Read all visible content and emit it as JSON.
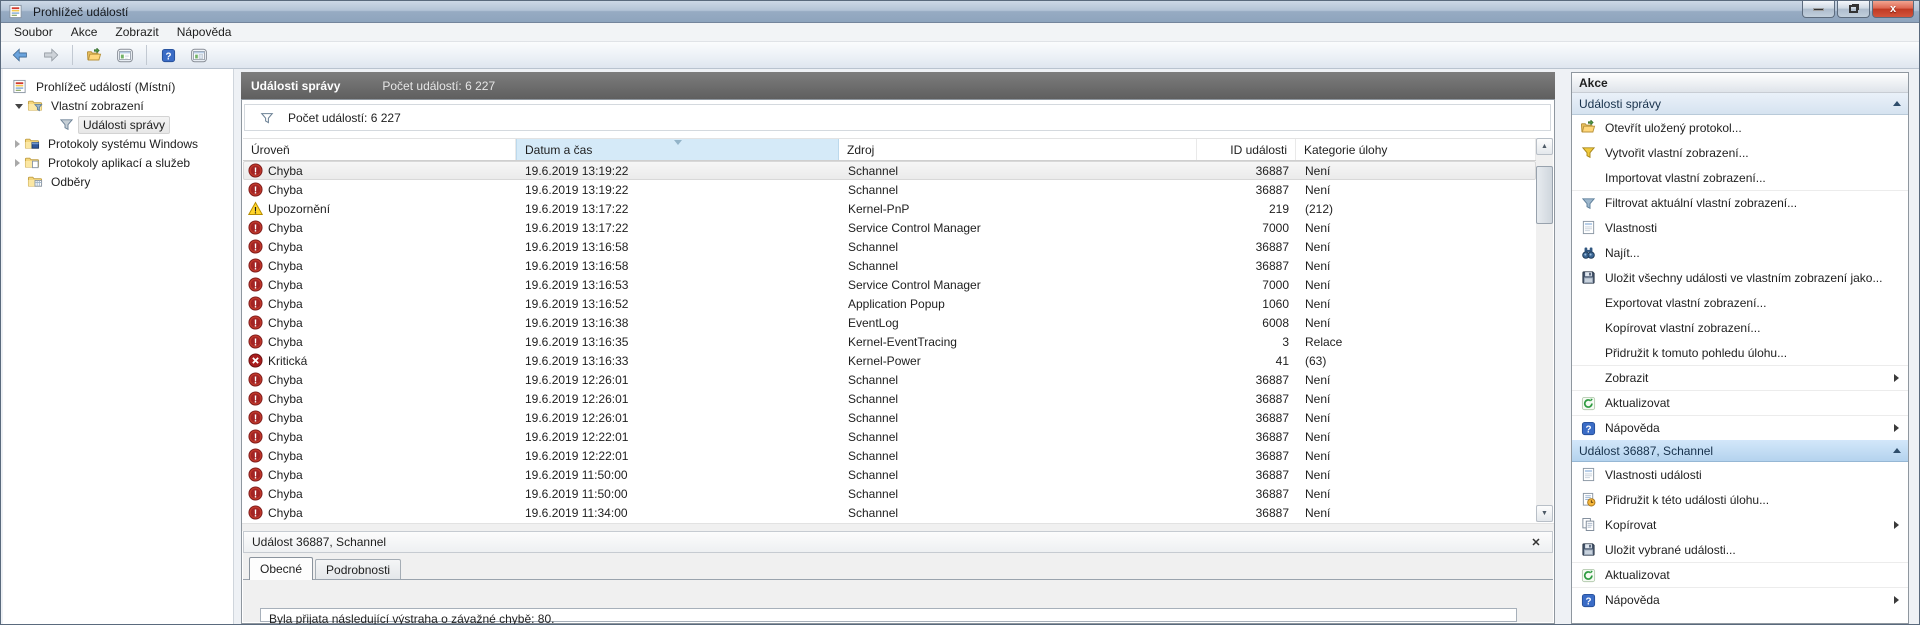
{
  "window": {
    "title": "Prohlížeč událostí",
    "controls": [
      {
        "name": "minimize-button",
        "icon": "minimize-icon"
      },
      {
        "name": "restore-button",
        "icon": "restore-icon"
      },
      {
        "name": "close-button",
        "icon": "close-icon",
        "glyph": "x"
      }
    ]
  },
  "menu": {
    "items": [
      "Soubor",
      "Akce",
      "Zobrazit",
      "Nápověda"
    ]
  },
  "toolbar": {
    "buttons": [
      {
        "name": "back-button",
        "icon": "back-arrow-icon"
      },
      {
        "name": "forward-button",
        "icon": "forward-arrow-icon"
      },
      {
        "name": "separator"
      },
      {
        "name": "open-saved-log-button",
        "icon": "open-folder-icon"
      },
      {
        "name": "show-console-tree-button",
        "icon": "console-tree-icon"
      },
      {
        "name": "separator"
      },
      {
        "name": "help-button",
        "icon": "help-icon"
      },
      {
        "name": "show-action-pane-button",
        "icon": "action-pane-icon"
      }
    ]
  },
  "tree": {
    "root": {
      "label": "Prohlížeč událostí (Místní)",
      "icon": "eventviewer-icon"
    },
    "items": [
      {
        "label": "Vlastní zobrazení",
        "level": 1,
        "expander": "expanded",
        "icon": "folder-filter-icon",
        "selected": false
      },
      {
        "label": "Události správy",
        "level": 2,
        "expander": "none",
        "icon": "filter-icon",
        "selected": true
      },
      {
        "label": "Protokoly systému Windows",
        "level": 1,
        "expander": "collapsed",
        "icon": "folder-system-icon",
        "selected": false
      },
      {
        "label": "Protokoly aplikací a služeb",
        "level": 1,
        "expander": "collapsed",
        "icon": "folder-app-icon",
        "selected": false
      },
      {
        "label": "Odběry",
        "level": 1,
        "expander": "none",
        "icon": "folder-subscription-icon",
        "selected": false
      }
    ]
  },
  "main": {
    "title": "Události správy",
    "subtitle": "Počet událostí: 6 227",
    "filter_summary": "Počet událostí: 6 227",
    "filter_icon": "funnel-icon"
  },
  "chart_data": {
    "type": "table",
    "title": "Události správy",
    "columns": [
      "Úroveň",
      "Datum a čas",
      "Zdroj",
      "ID události",
      "Kategorie úlohy"
    ],
    "sorted_column": "Datum a čas",
    "sort_direction": "desc",
    "rows": [
      {
        "level": "Chyba",
        "severity": "error",
        "datetime": "19.6.2019 13:19:22",
        "source": "Schannel",
        "event_id": "36887",
        "category": "Není",
        "selected": true
      },
      {
        "level": "Chyba",
        "severity": "error",
        "datetime": "19.6.2019 13:19:22",
        "source": "Schannel",
        "event_id": "36887",
        "category": "Není",
        "selected": false
      },
      {
        "level": "Upozornění",
        "severity": "warning",
        "datetime": "19.6.2019 13:17:22",
        "source": "Kernel-PnP",
        "event_id": "219",
        "category": "(212)",
        "selected": false
      },
      {
        "level": "Chyba",
        "severity": "error",
        "datetime": "19.6.2019 13:17:22",
        "source": "Service Control Manager",
        "event_id": "7000",
        "category": "Není",
        "selected": false
      },
      {
        "level": "Chyba",
        "severity": "error",
        "datetime": "19.6.2019 13:16:58",
        "source": "Schannel",
        "event_id": "36887",
        "category": "Není",
        "selected": false
      },
      {
        "level": "Chyba",
        "severity": "error",
        "datetime": "19.6.2019 13:16:58",
        "source": "Schannel",
        "event_id": "36887",
        "category": "Není",
        "selected": false
      },
      {
        "level": "Chyba",
        "severity": "error",
        "datetime": "19.6.2019 13:16:53",
        "source": "Service Control Manager",
        "event_id": "7000",
        "category": "Není",
        "selected": false
      },
      {
        "level": "Chyba",
        "severity": "error",
        "datetime": "19.6.2019 13:16:52",
        "source": "Application Popup",
        "event_id": "1060",
        "category": "Není",
        "selected": false
      },
      {
        "level": "Chyba",
        "severity": "error",
        "datetime": "19.6.2019 13:16:38",
        "source": "EventLog",
        "event_id": "6008",
        "category": "Není",
        "selected": false
      },
      {
        "level": "Chyba",
        "severity": "error",
        "datetime": "19.6.2019 13:16:35",
        "source": "Kernel-EventTracing",
        "event_id": "3",
        "category": "Relace",
        "selected": false
      },
      {
        "level": "Kritická",
        "severity": "critical",
        "datetime": "19.6.2019 13:16:33",
        "source": "Kernel-Power",
        "event_id": "41",
        "category": "(63)",
        "selected": false
      },
      {
        "level": "Chyba",
        "severity": "error",
        "datetime": "19.6.2019 12:26:01",
        "source": "Schannel",
        "event_id": "36887",
        "category": "Není",
        "selected": false
      },
      {
        "level": "Chyba",
        "severity": "error",
        "datetime": "19.6.2019 12:26:01",
        "source": "Schannel",
        "event_id": "36887",
        "category": "Není",
        "selected": false
      },
      {
        "level": "Chyba",
        "severity": "error",
        "datetime": "19.6.2019 12:26:01",
        "source": "Schannel",
        "event_id": "36887",
        "category": "Není",
        "selected": false
      },
      {
        "level": "Chyba",
        "severity": "error",
        "datetime": "19.6.2019 12:22:01",
        "source": "Schannel",
        "event_id": "36887",
        "category": "Není",
        "selected": false
      },
      {
        "level": "Chyba",
        "severity": "error",
        "datetime": "19.6.2019 12:22:01",
        "source": "Schannel",
        "event_id": "36887",
        "category": "Není",
        "selected": false
      },
      {
        "level": "Chyba",
        "severity": "error",
        "datetime": "19.6.2019 11:50:00",
        "source": "Schannel",
        "event_id": "36887",
        "category": "Není",
        "selected": false
      },
      {
        "level": "Chyba",
        "severity": "error",
        "datetime": "19.6.2019 11:50:00",
        "source": "Schannel",
        "event_id": "36887",
        "category": "Není",
        "selected": false
      },
      {
        "level": "Chyba",
        "severity": "error",
        "datetime": "19.6.2019 11:34:00",
        "source": "Schannel",
        "event_id": "36887",
        "category": "Není",
        "selected": false
      }
    ]
  },
  "preview": {
    "title": "Událost 36887, Schannel",
    "close_icon": "close-icon",
    "tabs": [
      {
        "label": "Obecné",
        "active": true
      },
      {
        "label": "Podrobnosti",
        "active": false
      }
    ],
    "message": "Byla přijata následující výstraha o závažné chybě: 80."
  },
  "actions": {
    "title": "Akce",
    "sections": [
      {
        "header": "Události správy",
        "highlighted": false,
        "items": [
          {
            "label": "Otevřít uložený protokol...",
            "icon": "open-folder-icon",
            "submenu": false,
            "sep_before": false
          },
          {
            "label": "Vytvořit vlastní zobrazení...",
            "icon": "funnel-yellow-icon",
            "submenu": false,
            "sep_before": false
          },
          {
            "label": "Importovat vlastní zobrazení...",
            "icon": "blank-icon",
            "submenu": false,
            "sep_before": false
          },
          {
            "label": "Filtrovat aktuální vlastní zobrazení...",
            "icon": "funnel-blue-icon",
            "submenu": false,
            "sep_before": true
          },
          {
            "label": "Vlastnosti",
            "icon": "properties-icon",
            "submenu": false,
            "sep_before": false
          },
          {
            "label": "Najít...",
            "icon": "find-icon",
            "submenu": false,
            "sep_before": false
          },
          {
            "label": "Uložit všechny události ve vlastním zobrazení jako...",
            "icon": "save-icon",
            "submenu": false,
            "sep_before": false
          },
          {
            "label": "Exportovat vlastní zobrazení...",
            "icon": "blank-icon",
            "submenu": false,
            "sep_before": false
          },
          {
            "label": "Kopírovat vlastní zobrazení...",
            "icon": "blank-icon",
            "submenu": false,
            "sep_before": false
          },
          {
            "label": "Přidružit k tomuto pohledu úlohu...",
            "icon": "blank-icon",
            "submenu": false,
            "sep_before": false
          },
          {
            "label": "Zobrazit",
            "icon": "blank-icon",
            "submenu": true,
            "sep_before": true
          },
          {
            "label": "Aktualizovat",
            "icon": "refresh-icon",
            "submenu": false,
            "sep_before": true
          },
          {
            "label": "Nápověda",
            "icon": "help-icon",
            "submenu": true,
            "sep_before": true
          }
        ]
      },
      {
        "header": "Událost 36887, Schannel",
        "highlighted": true,
        "items": [
          {
            "label": "Vlastnosti události",
            "icon": "properties-icon",
            "submenu": false,
            "sep_before": false
          },
          {
            "label": "Přidružit k této události úlohu...",
            "icon": "task-icon",
            "submenu": false,
            "sep_before": false
          },
          {
            "label": "Kopírovat",
            "icon": "copy-icon",
            "submenu": true,
            "sep_before": false
          },
          {
            "label": "Uložit vybrané události...",
            "icon": "save-icon",
            "submenu": false,
            "sep_before": false
          },
          {
            "label": "Aktualizovat",
            "icon": "refresh-icon",
            "submenu": false,
            "sep_before": true
          },
          {
            "label": "Nápověda",
            "icon": "help-icon",
            "submenu": true,
            "sep_before": true
          }
        ]
      }
    ]
  },
  "colors": {
    "titlebar": "#a9bbd0",
    "header_bar": "#6a6a6a",
    "sorted_column": "#d5eaf8",
    "section_highlight": "#c3dcf3",
    "error": "#a32424",
    "warning": "#ffd42a",
    "critical": "#a81e1e",
    "selection": "#f1f1f1"
  }
}
